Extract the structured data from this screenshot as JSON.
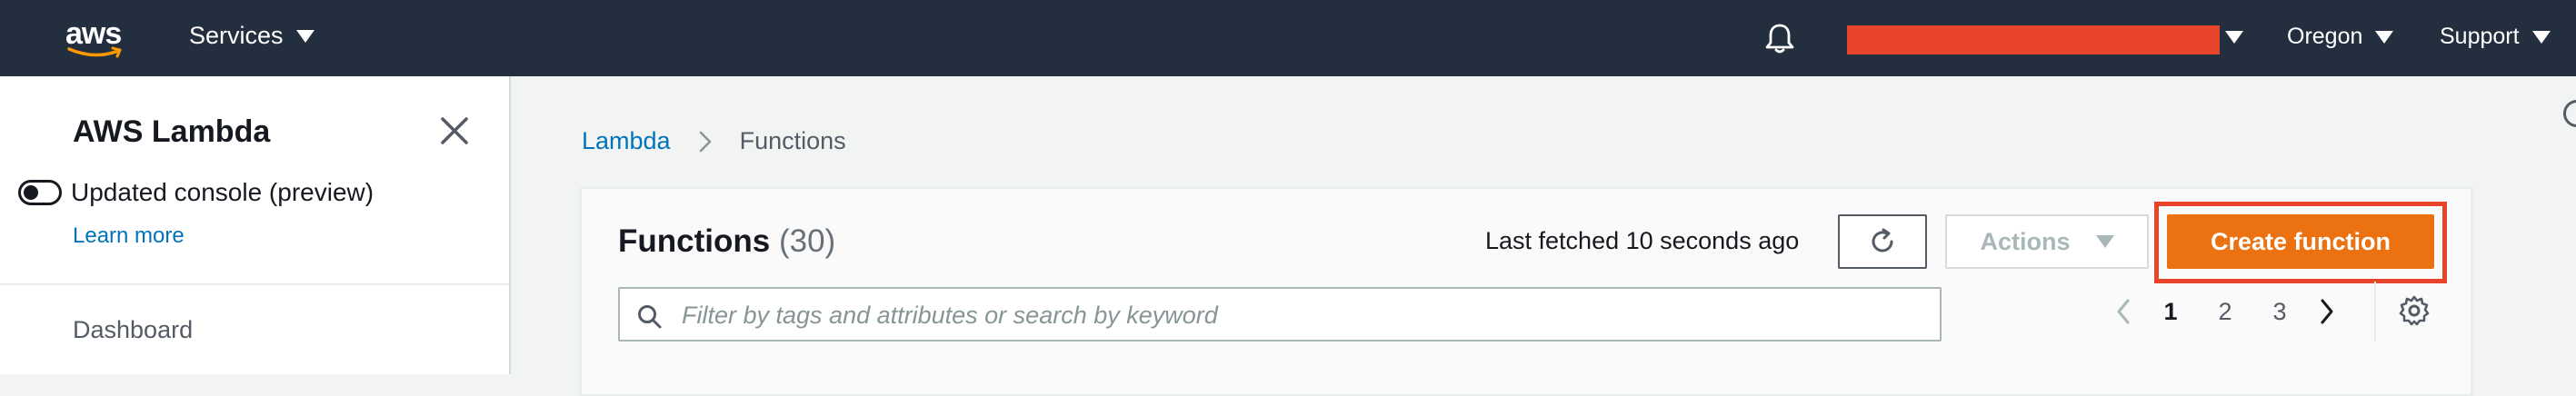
{
  "topnav": {
    "logo_text": "aws",
    "services_label": "Services",
    "region_label": "Oregon",
    "support_label": "Support",
    "bell_icon": "bell-icon",
    "account_redacted_color": "#e8432b"
  },
  "sidebar": {
    "title": "AWS Lambda",
    "close_icon": "close-icon",
    "toggle_label": "Updated console (preview)",
    "toggle_on": false,
    "learn_more": "Learn more",
    "items": [
      {
        "label": "Dashboard"
      }
    ]
  },
  "breadcrumb": {
    "items": [
      {
        "label": "Lambda",
        "link": true
      },
      {
        "label": "Functions",
        "link": false
      }
    ]
  },
  "functions_panel": {
    "title": "Functions",
    "count": "(30)",
    "last_fetched": "Last fetched 10 seconds ago",
    "refresh_icon": "refresh-icon",
    "actions_label": "Actions",
    "create_label": "Create function",
    "search_placeholder": "Filter by tags and attributes or search by keyword",
    "search_value": "",
    "pagination": {
      "pages": [
        "1",
        "2",
        "3"
      ],
      "current": "1"
    },
    "settings_icon": "gear-icon"
  },
  "colors": {
    "nav_bg": "#232f3e",
    "accent_orange": "#ec7211",
    "link_blue": "#0073bb",
    "highlight_red": "#e8432b"
  }
}
